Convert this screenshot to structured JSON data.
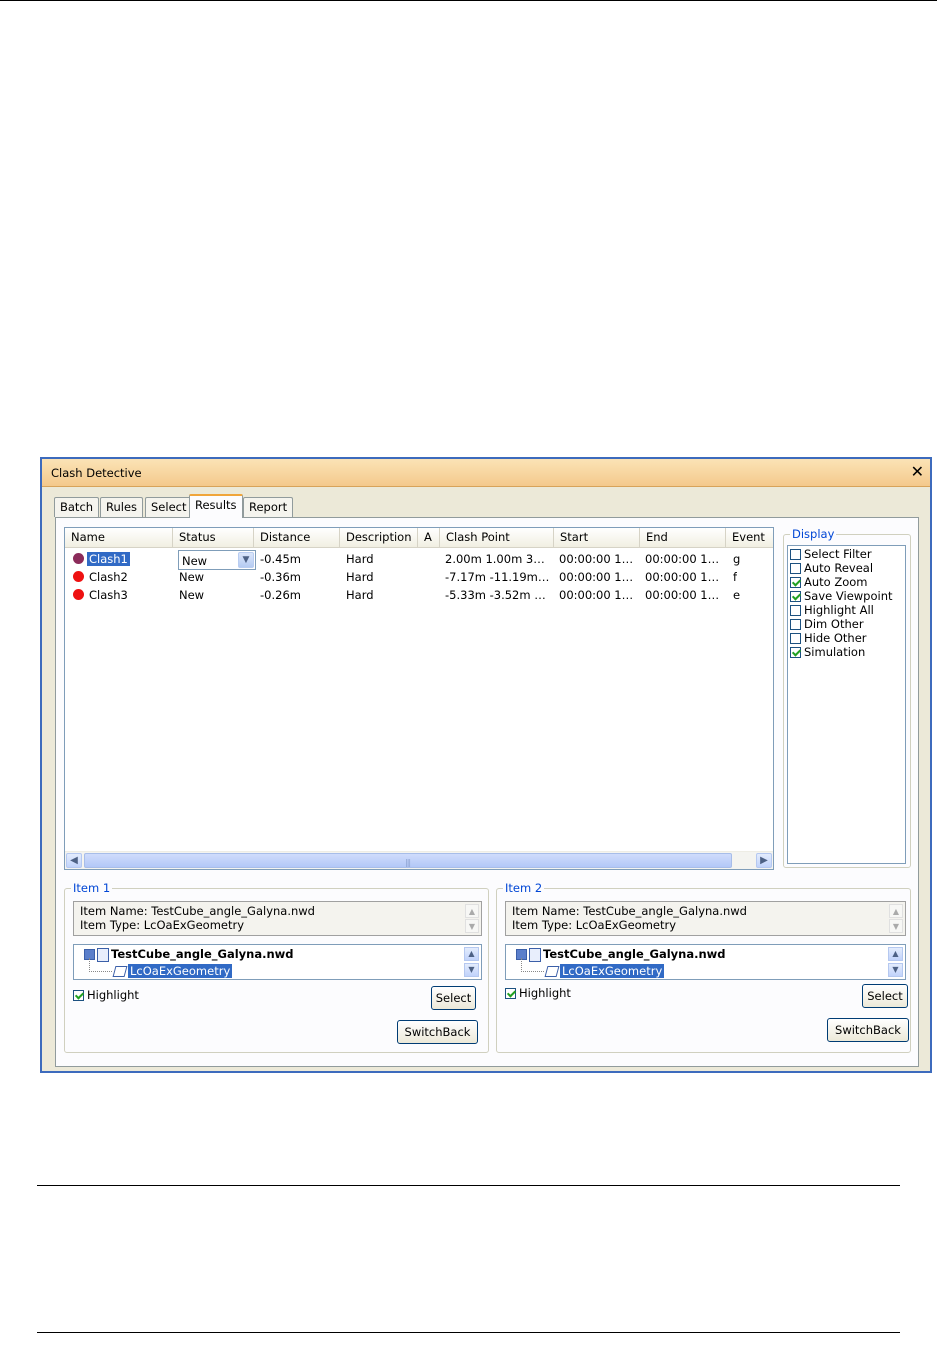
{
  "window": {
    "title": "Clash Detective",
    "close_glyph": "✕"
  },
  "tabs": [
    {
      "label": "Batch"
    },
    {
      "label": "Rules"
    },
    {
      "label": "Select"
    },
    {
      "label": "Results"
    },
    {
      "label": "Report"
    }
  ],
  "active_tab": "Results",
  "results": {
    "columns": [
      "Name",
      "Status",
      "Distance",
      "Description",
      "A",
      "Clash Point",
      "Start",
      "End",
      "Event"
    ],
    "rows": [
      {
        "name": "Clash1",
        "status": "New",
        "distance": "-0.45m",
        "description": "Hard",
        "approved": "",
        "clash_point": "2.00m  1.00m  3…",
        "start": "00:00:00 1…",
        "end": "00:00:00 1…",
        "event": "g",
        "dot_color": "#8b2b5a",
        "selected": true
      },
      {
        "name": "Clash2",
        "status": "New",
        "distance": "-0.36m",
        "description": "Hard",
        "approved": "",
        "clash_point": "-7.17m  -11.19m…",
        "start": "00:00:00 1…",
        "end": "00:00:00 1…",
        "event": "f",
        "dot_color": "#ee1111",
        "selected": false
      },
      {
        "name": "Clash3",
        "status": "New",
        "distance": "-0.26m",
        "description": "Hard",
        "approved": "",
        "clash_point": "-5.33m  -3.52m  …",
        "start": "00:00:00 1…",
        "end": "00:00:00 1…",
        "event": "e",
        "dot_color": "#ee1111",
        "selected": false
      }
    ],
    "status_editor_value": "New"
  },
  "display": {
    "label": "Display",
    "options": [
      {
        "label": "Select Filter",
        "checked": false
      },
      {
        "label": "Auto Reveal",
        "checked": false
      },
      {
        "label": "Auto Zoom",
        "checked": true
      },
      {
        "label": "Save Viewpoint",
        "checked": true
      },
      {
        "label": "Highlight All",
        "checked": false
      },
      {
        "label": "Dim Other",
        "checked": false
      },
      {
        "label": "Hide Other",
        "checked": false
      },
      {
        "label": "Simulation",
        "checked": true
      }
    ]
  },
  "item1": {
    "label": "Item 1",
    "item_name": "Item Name: TestCube_angle_Galyna.nwd",
    "item_type": "Item Type: LcOaExGeometry",
    "tree_root": "TestCube_angle_Galyna.nwd",
    "tree_child": "LcOaExGeometry",
    "highlight_label": "Highlight",
    "highlight_checked": true,
    "select_label": "Select",
    "switchback_label": "SwitchBack"
  },
  "item2": {
    "label": "Item 2",
    "item_name": "Item Name: TestCube_angle_Galyna.nwd",
    "item_type": "Item Type: LcOaExGeometry",
    "tree_root": "TestCube_angle_Galyna.nwd",
    "tree_child": "LcOaExGeometry",
    "highlight_label": "Highlight",
    "highlight_checked": true,
    "select_label": "Select",
    "switchback_label": "SwitchBack"
  },
  "colors": {
    "accent": "#316ac5",
    "title_bar": "#f4c98c",
    "group_label": "#0046d5",
    "clash_new": "#ee1111",
    "clash_active": "#8b2b5a"
  }
}
